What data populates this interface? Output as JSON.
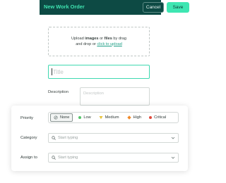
{
  "header": {
    "title": "New Work Order",
    "cancel_label": "Cancel",
    "save_label": "Save",
    "colors": {
      "bar": "#0d4a44",
      "accent": "#3ee6b2"
    }
  },
  "upload": {
    "text_prefix": "Upload ",
    "text_images": "images",
    "text_or": " or ",
    "text_files": "files",
    "text_by_drag": " by drag",
    "text_line2": "and drop or ",
    "link_label": "click to upload"
  },
  "title_field": {
    "placeholder": "Title"
  },
  "description": {
    "label": "Description",
    "placeholder": "Description"
  },
  "priority": {
    "label": "Priority",
    "options": [
      {
        "label": "None",
        "icon": "none-icon",
        "color": "#8a9593"
      },
      {
        "label": "Low",
        "icon": "dot-icon",
        "color": "#54c46a"
      },
      {
        "label": "Medium",
        "icon": "medium-icon",
        "color": "#e8c33a"
      },
      {
        "label": "High",
        "icon": "high-icon",
        "color": "#f08a2a"
      },
      {
        "label": "Critical",
        "icon": "dot-icon",
        "color": "#e0493c"
      }
    ],
    "selected": "None"
  },
  "category": {
    "label": "Category",
    "placeholder": "Start typing"
  },
  "assign_to": {
    "label": "Assign to",
    "placeholder": "Start typing"
  }
}
